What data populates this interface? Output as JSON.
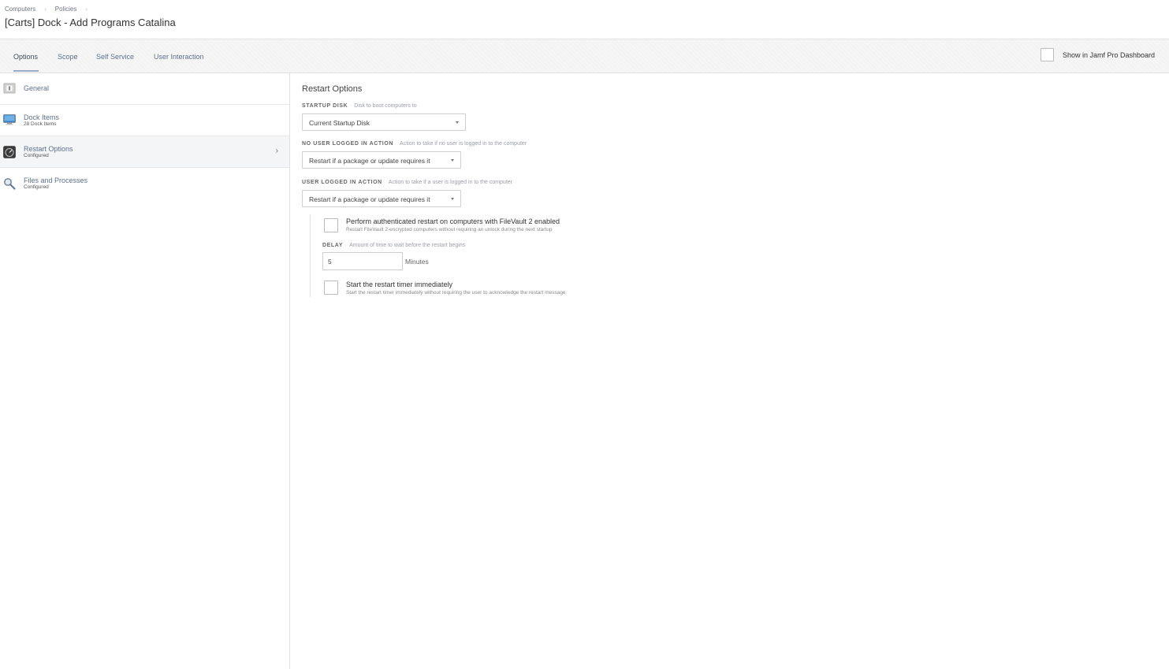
{
  "breadcrumb": {
    "items": [
      "Computers",
      "Policies"
    ],
    "separator": "›"
  },
  "page": {
    "title": "[Carts] Dock - Add Programs Catalina"
  },
  "tabs": [
    {
      "label": "Options",
      "active": true
    },
    {
      "label": "Scope",
      "active": false
    },
    {
      "label": "Self Service",
      "active": false
    },
    {
      "label": "User Interaction",
      "active": false
    }
  ],
  "dashboard": {
    "label": "Show in Jamf Pro Dashboard",
    "checked": false
  },
  "sidebar": {
    "items": [
      {
        "title": "General",
        "subtitle": "",
        "icon": "general-icon"
      },
      {
        "title": "Dock Items",
        "subtitle": "28 Dock Items",
        "icon": "monitor-icon"
      },
      {
        "title": "Restart Options",
        "subtitle": "Configured",
        "icon": "restart-gauge-icon",
        "active": true
      },
      {
        "title": "Files and Processes",
        "subtitle": "Configured",
        "icon": "magnifier-icon"
      }
    ],
    "chevron": "›"
  },
  "main": {
    "section_title": "Restart Options",
    "startup_disk": {
      "label": "STARTUP DISK",
      "hint": "Disk to boot computers to",
      "value": "Current Startup Disk"
    },
    "no_user": {
      "label": "NO USER LOGGED IN ACTION",
      "hint": "Action to take if no user is logged in to the computer",
      "value": "Restart if a package or update requires it"
    },
    "user_logged": {
      "label": "USER LOGGED IN ACTION",
      "hint": "Action to take if a user is logged in to the computer",
      "value": "Restart if a package or update requires it"
    },
    "filevault": {
      "title": "Perform authenticated restart on computers with FileVault 2 enabled",
      "subtitle": "Restart FileVault 2-encrypted computers without requiring an unlock during the next startup",
      "checked": false
    },
    "delay": {
      "label": "DELAY",
      "hint": "Amount of time to wait before the restart begins",
      "value": "5",
      "unit": "Minutes"
    },
    "timer": {
      "title": "Start the restart timer immediately",
      "subtitle": "Start the restart timer immediately without requiring the user to acknowledge the restart message",
      "checked": false
    }
  },
  "colors": {
    "link": "#5d6f8f",
    "accent_underline": "#9aaecb",
    "border": "#e0e0e0"
  }
}
